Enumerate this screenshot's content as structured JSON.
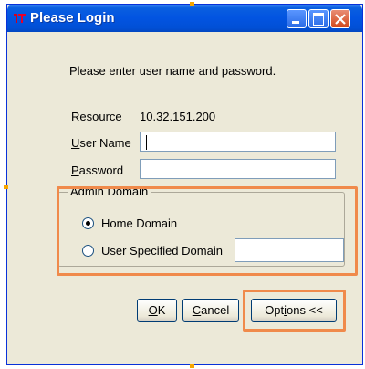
{
  "window": {
    "title": "Please Login"
  },
  "dialog": {
    "instruction": "Please enter user name and password.",
    "resource_label": "Resource",
    "resource_value": "10.32.151.200",
    "username_label_u": "U",
    "username_label_rest": "ser Name",
    "username_value": "",
    "password_label_u": "P",
    "password_label_rest": "assword",
    "password_value": "",
    "admin_domain": {
      "legend": "Admin Domain",
      "home_domain_label": "Home Domain",
      "user_specified_label": "User Specified Domain",
      "user_specified_value": "",
      "selected": "Home Domain"
    },
    "buttons": {
      "ok_u": "O",
      "ok_rest": "K",
      "cancel_u": "C",
      "cancel_rest": "ancel",
      "options_pre": "Opt",
      "options_u": "i",
      "options_post": "ons <<"
    }
  },
  "colors": {
    "titlebar": "#0254e1",
    "highlight": "#f08a4b",
    "dialog_bg": "#ece9d8"
  },
  "icons": [
    "app-icon",
    "minimize-icon",
    "maximize-icon",
    "close-icon"
  ]
}
